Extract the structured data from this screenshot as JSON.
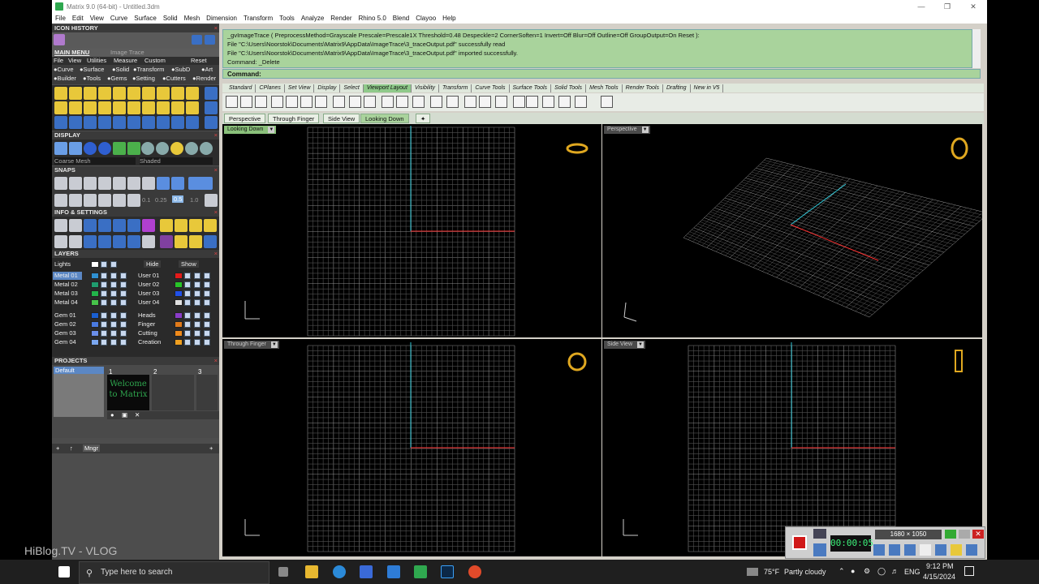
{
  "window": {
    "title": "Matrix 9.0 (64-bit) - Untitled.3dm"
  },
  "menu": [
    "File",
    "Edit",
    "View",
    "Curve",
    "Surface",
    "Solid",
    "Mesh",
    "Dimension",
    "Transform",
    "Tools",
    "Analyze",
    "Render",
    "Rhino 5.0",
    "Blend",
    "Clayoo",
    "Help"
  ],
  "left": {
    "icon_history": "ICON HISTORY",
    "main_menu_tab": "MAIN MENU",
    "image_trace_tab": "Image Trace",
    "submenu": [
      "File",
      "View",
      "Utilities",
      "Measure",
      "Custom"
    ],
    "reset": "Reset",
    "categories_row1": [
      "Curve",
      "Surface",
      "Solid",
      "Transform",
      "SubD",
      "Art"
    ],
    "categories_row2": [
      "Builder",
      "Tools",
      "Gems",
      "Setting",
      "Cutters",
      "Render"
    ],
    "display": "DISPLAY",
    "display_mode1": "Coarse Mesh",
    "display_mode2": "Shaded",
    "snaps": "SNAPS",
    "snap_values": [
      "0.1",
      "0.25",
      "0.5",
      "1.0"
    ],
    "info": "INFO & SETTINGS",
    "layers": "LAYERS",
    "lights": "Lights",
    "hide": "Hide",
    "show": "Show",
    "layers_left": [
      "Metal 01",
      "Metal 02",
      "Metal 03",
      "Metal 04",
      "Gem 01",
      "Gem 02",
      "Gem 03",
      "Gem 04"
    ],
    "layers_right": [
      "User 01",
      "User 02",
      "User 03",
      "User 04",
      "Heads",
      "Finger",
      "Cutting",
      "Creation"
    ],
    "projects": "PROJECTS",
    "default": "Default",
    "project_nums": [
      "1",
      "2",
      "3"
    ],
    "project_caption": "Welcome to Matrix",
    "mngr": "Mngr"
  },
  "command": {
    "line1": "_gvImageTrace ( PreprocessMethod=Grayscale  Prescale=Prescale1X  Threshold=0.48  Despeckle=2  CornerSoften=1  Invert=Off  Blur=Off  Outline=Off  GroupOutput=On  Reset ):",
    "line2": "File \"C:\\Users\\Noorstok\\Documents\\Matrix9\\AppData\\ImageTrace\\3_traceOutput.pdf\" successfully read",
    "line3": "File \"C:\\Users\\Noorstok\\Documents\\Matrix9\\AppData\\ImageTrace\\3_traceOutput.pdf\" imported successfully.",
    "line4": "Command: _Delete",
    "prompt": "Command:"
  },
  "tool_tabs": [
    "Standard",
    "CPlanes",
    "Set View",
    "Display",
    "Select",
    "Viewport Layout",
    "Visibility",
    "Transform",
    "Curve Tools",
    "Surface Tools",
    "Solid Tools",
    "Mesh Tools",
    "Render Tools",
    "Drafting",
    "New in V5"
  ],
  "viewport_tabs": [
    "Perspective",
    "Through Finger",
    "Side View",
    "Looking Down"
  ],
  "viewports": {
    "tl": "Looking Down",
    "tr": "Perspective",
    "bl": "Through Finger",
    "br": "Side View"
  },
  "recorder": {
    "timer": "00:00:05",
    "resolution": "1680 × 1050"
  },
  "watermark": "HiBlog.TV - VLOG",
  "taskbar": {
    "search_placeholder": "Type here to search",
    "weather_temp": "75°F",
    "weather_text": "Partly cloudy",
    "lang": "ENG",
    "time": "9:12 PM",
    "date": "4/15/2024"
  },
  "colors": {
    "accent_green": "#a9d39c",
    "axis_red": "#ff3030",
    "axis_cyan": "#30c8d8"
  }
}
